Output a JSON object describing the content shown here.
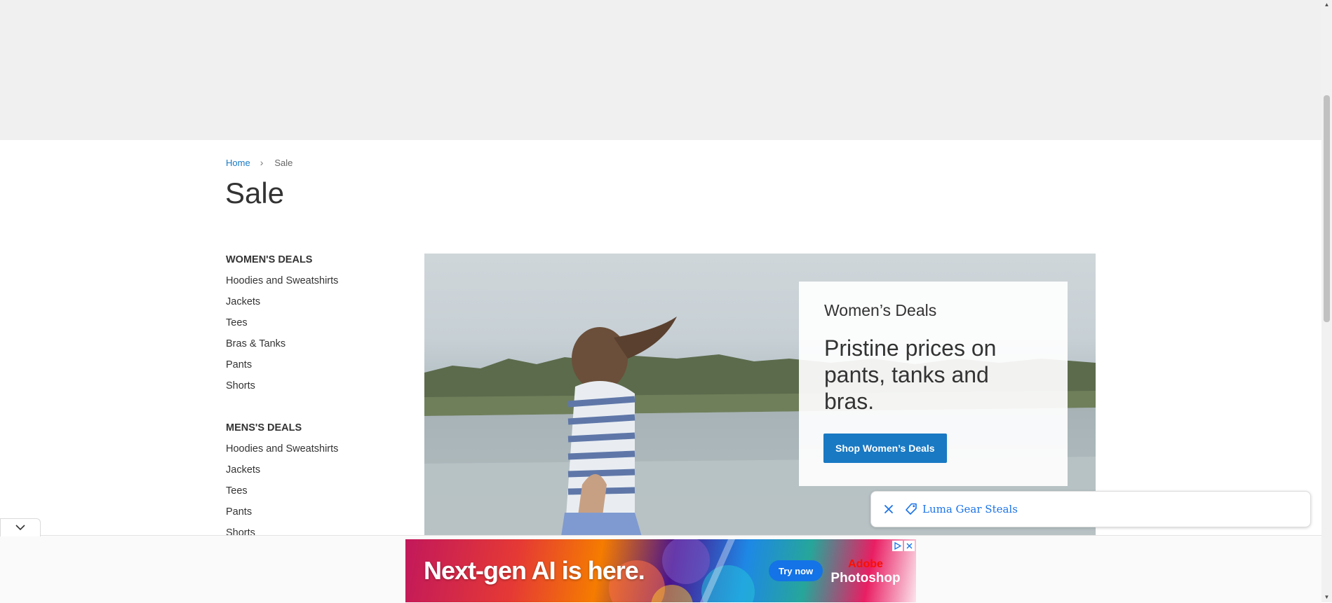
{
  "breadcrumb": {
    "home": "Home",
    "separator": "›",
    "current": "Sale"
  },
  "page": {
    "title": "Sale"
  },
  "sidebar": {
    "womens": {
      "heading": "WOMEN'S DEALS",
      "items": [
        "Hoodies and Sweatshirts",
        "Jackets",
        "Tees",
        "Bras & Tanks",
        "Pants",
        "Shorts"
      ]
    },
    "mens": {
      "heading": "MENS'S DEALS",
      "items": [
        "Hoodies and Sweatshirts",
        "Jackets",
        "Tees",
        "Pants",
        "Shorts"
      ]
    }
  },
  "promo": {
    "eyebrow": "Women’s Deals",
    "heading": "Pristine prices on pants, tanks and bras.",
    "button_label": "Shop Women’s Deals"
  },
  "toast": {
    "close_icon": "close-icon",
    "tag_icon": "tag-icon",
    "link_text": "Luma Gear Steals"
  },
  "ad": {
    "headline": "Next-gen AI is here.",
    "cta_label": "Try now",
    "brand_top": "Adobe",
    "brand_bottom": "Photoshop"
  },
  "colors": {
    "accent": "#1979c3",
    "link": "#1a73e8",
    "text": "#333333",
    "header_bg": "#f0f0f0"
  }
}
